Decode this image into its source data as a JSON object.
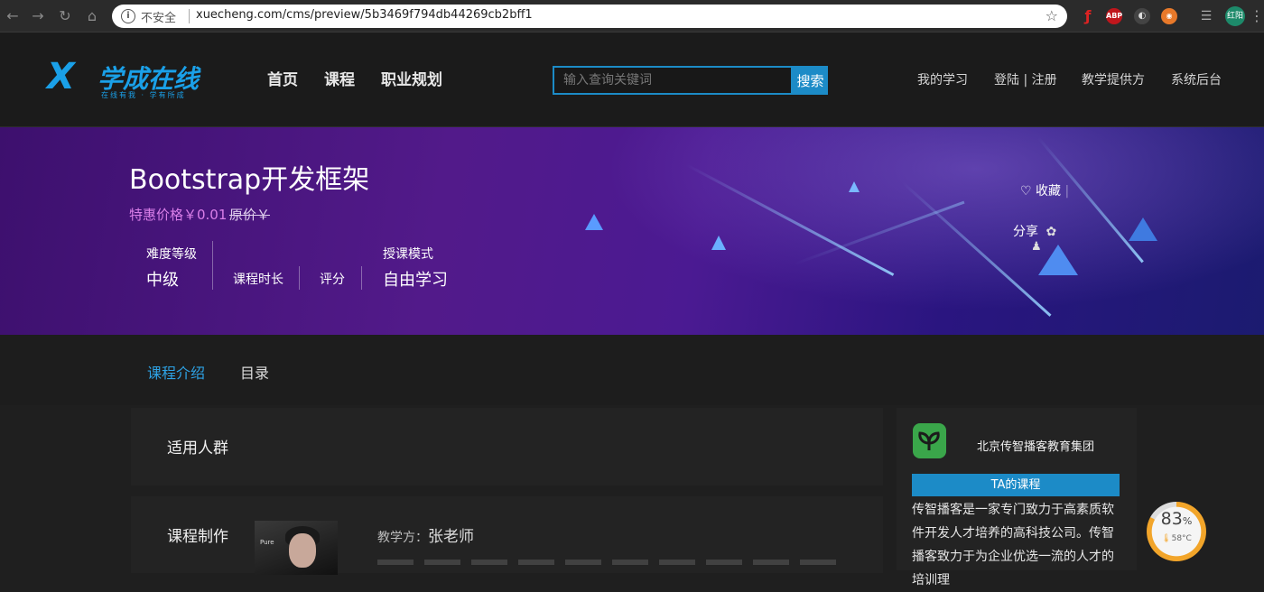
{
  "browser": {
    "insecure_label": "不安全",
    "url": "xuecheng.com/cms/preview/5b3469f794db44269cb2bff1",
    "profile_label": "红阳",
    "ext_abp": "ABP"
  },
  "site": {
    "logo_mark": "X",
    "logo_name": "学成在线",
    "logo_slogan": "在线有我 · 学有所成",
    "nav": [
      "首页",
      "课程",
      "职业规划"
    ],
    "search_placeholder": "输入查询关键词",
    "search_button": "搜索",
    "user_nav": {
      "my_learning": "我的学习",
      "login_register": "登陆 | 注册",
      "teaching_provider": "教学提供方",
      "admin": "系统后台"
    }
  },
  "course": {
    "title": "Bootstrap开发框架",
    "price_label": "特惠价格￥0.01",
    "original_price": "原价￥",
    "difficulty_label": "难度等级",
    "difficulty_value": "中级",
    "duration_label": "课程时长",
    "rating_label": "评分",
    "mode_label": "授课模式",
    "mode_value": "自由学习",
    "favorite": "收藏",
    "share": "分享"
  },
  "tabs": {
    "intro": "课程介绍",
    "catalog": "目录",
    "active_color": "#2ea3e6"
  },
  "content": {
    "audience_title": "适用人群",
    "production_title": "课程制作",
    "teacher_label": "教学方：",
    "teacher_name": "张老师",
    "photo_caption": "Pure"
  },
  "org": {
    "name": "北京传智播客教育集团",
    "ta_courses": "TA的课程",
    "description": "传智播客是一家专门致力于高素质软件开发人才培养的高科技公司。传智播客致力于为企业优选一流的人才的培训理"
  },
  "system_gauge": {
    "percent": "83",
    "percent_unit": "%",
    "temperature": "58°C",
    "level": 0.83
  }
}
